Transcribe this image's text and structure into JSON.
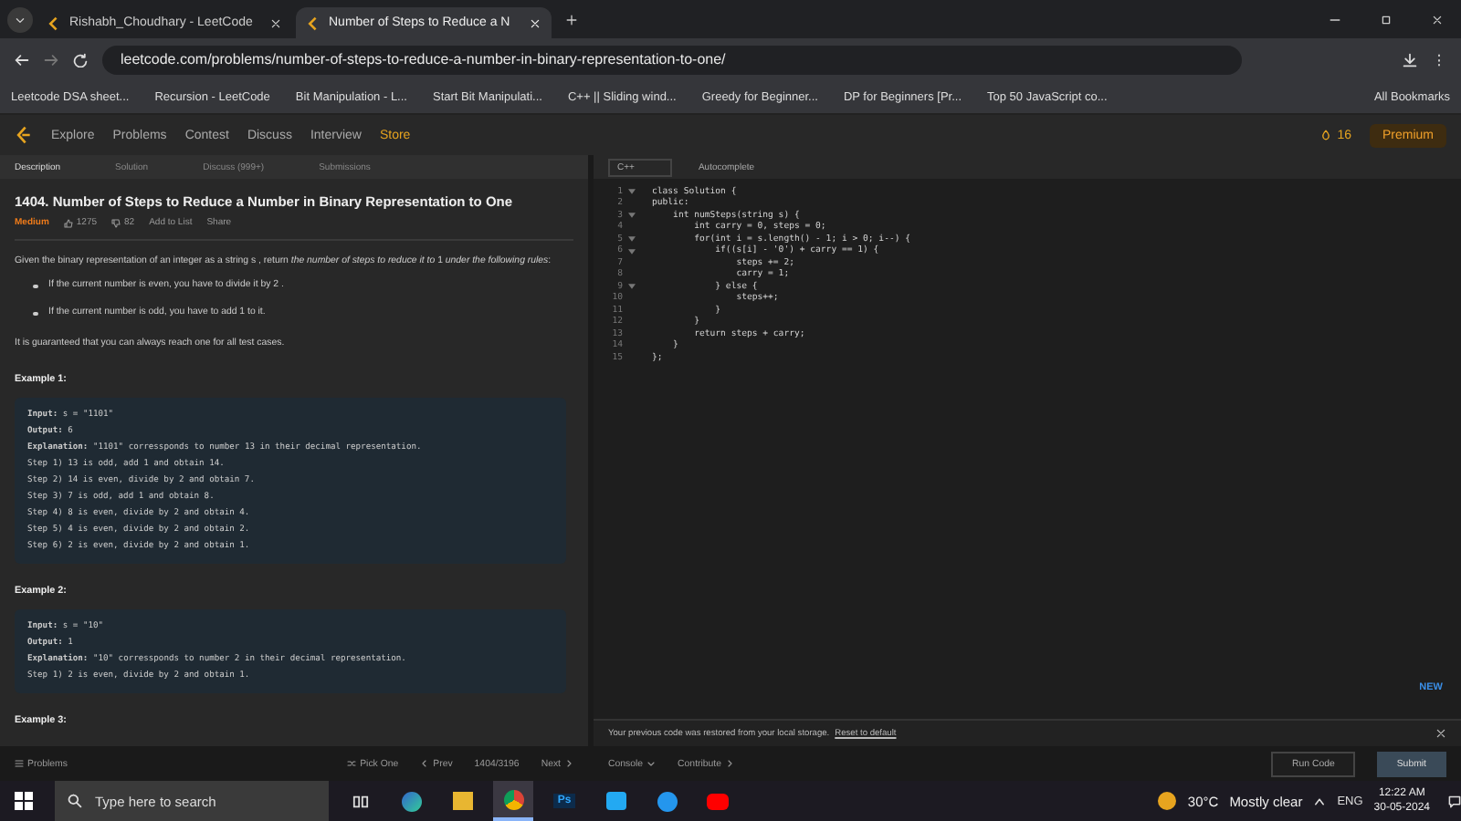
{
  "browser": {
    "tabs": [
      {
        "title": "Rishabh_Choudhary - LeetCode",
        "selected": false
      },
      {
        "title": "Number of Steps to Reduce a N",
        "selected": true
      }
    ],
    "url": "leetcode.com/problems/number-of-steps-to-reduce-a-number-in-binary-representation-to-one/",
    "bookmarks": [
      {
        "label": "Leetcode DSA sheet..."
      },
      {
        "label": "Recursion - LeetCode"
      },
      {
        "label": "Bit Manipulation - L..."
      },
      {
        "label": "Start Bit Manipulati..."
      },
      {
        "label": "C++ || Sliding wind..."
      },
      {
        "label": "Greedy for Beginner..."
      },
      {
        "label": "DP for Beginners [Pr..."
      },
      {
        "label": "Top 50 JavaScript co..."
      }
    ],
    "all_bookmarks": "All Bookmarks"
  },
  "nav": {
    "links": [
      {
        "label": "Explore"
      },
      {
        "label": "Problems"
      },
      {
        "label": "Contest"
      },
      {
        "label": "Discuss"
      },
      {
        "label": "Interview"
      }
    ],
    "store": "Store",
    "streak": "16",
    "premium": "Premium"
  },
  "panel_tabs": [
    {
      "label": "Description",
      "selected": true
    },
    {
      "label": "Solution",
      "selected": false
    },
    {
      "label": "Discuss (999+)",
      "selected": false
    },
    {
      "label": "Submissions",
      "selected": false
    }
  ],
  "problem": {
    "title": "1404. Number of Steps to Reduce a Number in Binary Representation to One",
    "difficulty": "Medium",
    "likes": "1275",
    "dislikes": "82",
    "add_to_list": "Add to List",
    "share": "Share",
    "intro": "Given the binary representation of an integer as a string s , return *the number of steps to reduce it to* 1 *under the following rules*:",
    "rules": [
      "If the current number is even, you have to divide it by 2 .",
      "If the current number is odd, you have to add 1 to it."
    ],
    "guarantee": "It is guaranteed that you can always reach one for all test cases.",
    "examples": [
      {
        "heading": "Example 1:",
        "lines": [
          "**Input:** s = \"1101\"",
          "**Output:** 6",
          "**Explanation:** \"1101\" corressponds to number 13 in their decimal representation.",
          "Step 1) 13 is odd, add 1 and obtain 14. ",
          "Step 2) 14 is even, divide by 2 and obtain 7.",
          "Step 3) 7 is odd, add 1 and obtain 8.",
          "Step 4) 8 is even, divide by 2 and obtain 4.  ",
          "Step 5) 4 is even, divide by 2 and obtain 2. ",
          "Step 6) 2 is even, divide by 2 and obtain 1."
        ]
      },
      {
        "heading": "Example 2:",
        "lines": [
          "**Input:** s = \"10\"",
          "**Output:** 1",
          "**Explanation:** \"10\" corressponds to number 2 in their decimal representation.",
          "Step 1) 2 is even, divide by 2 and obtain 1."
        ]
      },
      {
        "heading": "Example 3:"
      }
    ]
  },
  "editor": {
    "language": "C++",
    "autocomplete": "Autocomplete",
    "lines": [
      {
        "number": "1",
        "text": "class Solution {",
        "foldable": true
      },
      {
        "number": "2",
        "text": "public:",
        "foldable": false
      },
      {
        "number": "3",
        "text": "    int numSteps(string s) {",
        "foldable": true
      },
      {
        "number": "4",
        "text": "        int carry = 0, steps = 0;",
        "foldable": false
      },
      {
        "number": "5",
        "text": "        for(int i = s.length() - 1; i > 0; i--) {",
        "foldable": true
      },
      {
        "number": "6",
        "text": "            if((s[i] - '0') + carry == 1) {",
        "foldable": true
      },
      {
        "number": "7",
        "text": "                steps += 2;",
        "foldable": false
      },
      {
        "number": "8",
        "text": "                carry = 1;",
        "foldable": false
      },
      {
        "number": "9",
        "text": "            } else {",
        "foldable": true
      },
      {
        "number": "10",
        "text": "                steps++;",
        "foldable": false
      },
      {
        "number": "11",
        "text": "            }",
        "foldable": false
      },
      {
        "number": "12",
        "text": "        }",
        "foldable": false
      },
      {
        "number": "13",
        "text": "        return steps + carry;",
        "foldable": false
      },
      {
        "number": "14",
        "text": "    }",
        "foldable": false
      },
      {
        "number": "15",
        "text": "};",
        "foldable": false
      }
    ],
    "badge": "NEW",
    "notice": "Your previous code was restored from your local storage.",
    "notice_link": "Reset to default"
  },
  "bottom_bar": {
    "problems": "Problems",
    "pick_one": "Pick One",
    "prev": "Prev",
    "counter": "1404/3196",
    "next": "Next",
    "console": "Console",
    "contribute": "Contribute",
    "run": "Run Code",
    "submit": "Submit"
  },
  "taskbar": {
    "search_placeholder": "Type here to search",
    "apps": [
      {
        "kind": "taskview",
        "selected": false
      },
      {
        "kind": "edge",
        "selected": false
      },
      {
        "kind": "files",
        "selected": false
      },
      {
        "kind": "chrome",
        "selected": true
      },
      {
        "kind": "photoshop",
        "label": "Ps",
        "selected": false
      },
      {
        "kind": "vscode",
        "selected": false
      },
      {
        "kind": "docker",
        "selected": false
      },
      {
        "kind": "youtube",
        "selected": false
      }
    ],
    "temperature": "30°C",
    "weather": "Mostly clear",
    "language": "ENG",
    "time": "12:22 AM",
    "date": "30-05-2024"
  }
}
